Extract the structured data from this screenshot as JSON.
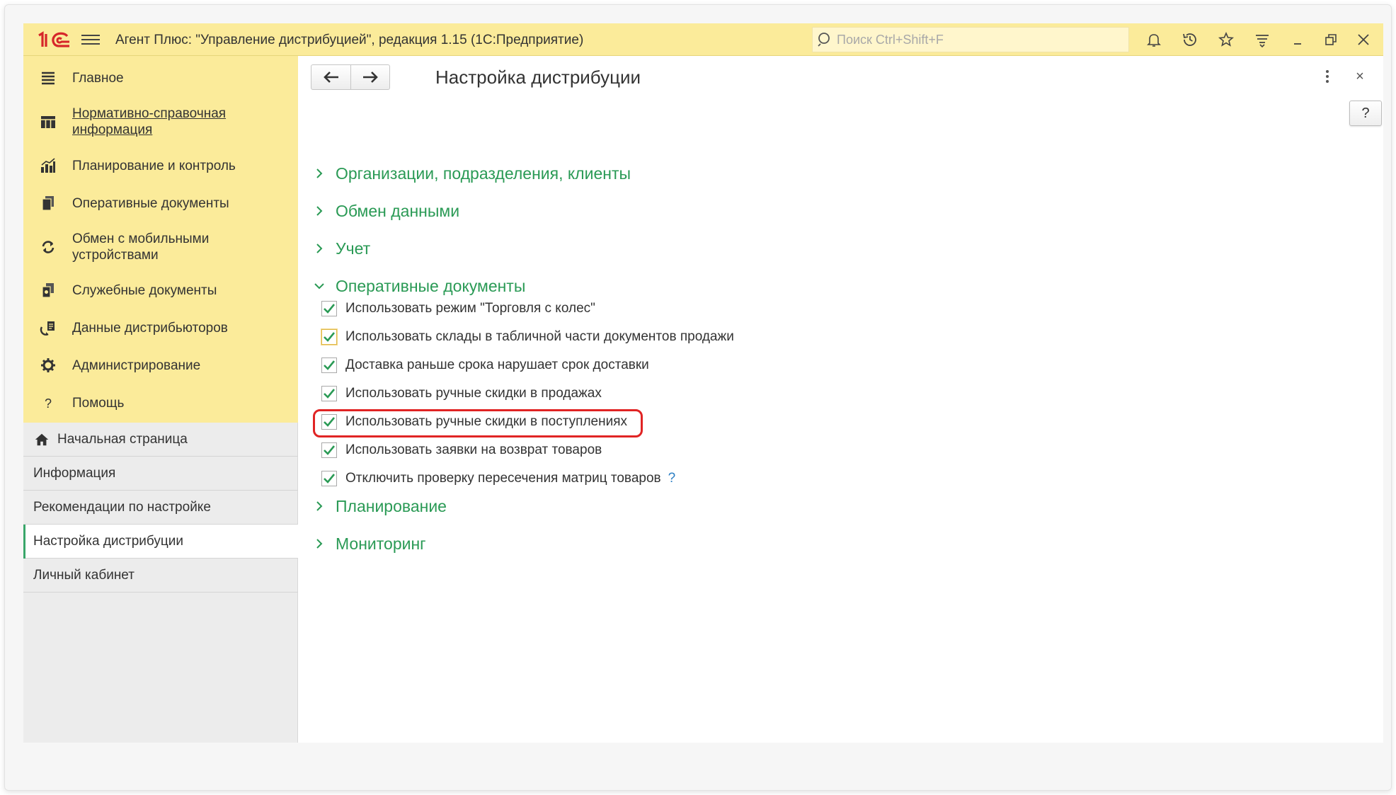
{
  "app": {
    "title": "Агент Плюс: \"Управление дистрибуцией\", редакция 1.15  (1С:Предприятие)",
    "search_placeholder": "Поиск Ctrl+Shift+F",
    "toolbar_icons": [
      "bell-icon",
      "history-icon",
      "star-icon",
      "menu-lines-icon",
      "minimize-icon",
      "restore-icon",
      "close-icon"
    ]
  },
  "sidebar": {
    "menu": [
      {
        "label": "Главное",
        "icon": "list-icon"
      },
      {
        "label": "Нормативно-справочная информация",
        "icon": "grid-icon",
        "link": true
      },
      {
        "label": "Планирование и контроль",
        "icon": "bar-chart-icon"
      },
      {
        "label": "Оперативные документы",
        "icon": "documents-icon"
      },
      {
        "label": "Обмен с мобильными устройствами",
        "icon": "sync-icon"
      },
      {
        "label": "Служебные документы",
        "icon": "service-docs-icon"
      },
      {
        "label": "Данные дистрибьюторов",
        "icon": "distributor-icon"
      },
      {
        "label": "Администрирование",
        "icon": "gear-icon"
      },
      {
        "label": "Помощь",
        "icon": "question-icon"
      }
    ],
    "open_windows": [
      {
        "label": "Начальная страница",
        "icon": "home-icon"
      },
      {
        "label": "Информация"
      },
      {
        "label": "Рекомендации по настройке"
      },
      {
        "label": "Настройка дистрибуции",
        "active": true
      },
      {
        "label": "Личный кабинет"
      }
    ]
  },
  "form": {
    "title": "Настройка дистрибуции",
    "help_label": "?",
    "close_label": "×",
    "sections": [
      {
        "label": "Организации, подразделения, клиенты",
        "expanded": false
      },
      {
        "label": "Обмен данными",
        "expanded": false
      },
      {
        "label": "Учет",
        "expanded": false
      },
      {
        "label": "Оперативные документы",
        "expanded": true
      },
      {
        "label": "Планирование",
        "expanded": false
      },
      {
        "label": "Мониторинг",
        "expanded": false
      }
    ],
    "checkboxes": [
      {
        "label": "Использовать режим \"Торговля с колес\"",
        "checked": true
      },
      {
        "label": "Использовать склады в табличной части документов продажи",
        "checked": true
      },
      {
        "label": "Доставка раньше срока нарушает срок доставки",
        "checked": true
      },
      {
        "label": "Использовать ручные скидки в продажах",
        "checked": true
      },
      {
        "label": "Использовать ручные скидки в поступлениях",
        "checked": true
      },
      {
        "label": "Использовать заявки на возврат товаров",
        "checked": true
      },
      {
        "label": "Отключить проверку пересечения матриц товаров",
        "checked": true,
        "help": "?"
      }
    ]
  },
  "colors": {
    "titlebar": "#fbeb9a",
    "accent_green": "#2a9a55",
    "highlight_red": "#e02424"
  }
}
